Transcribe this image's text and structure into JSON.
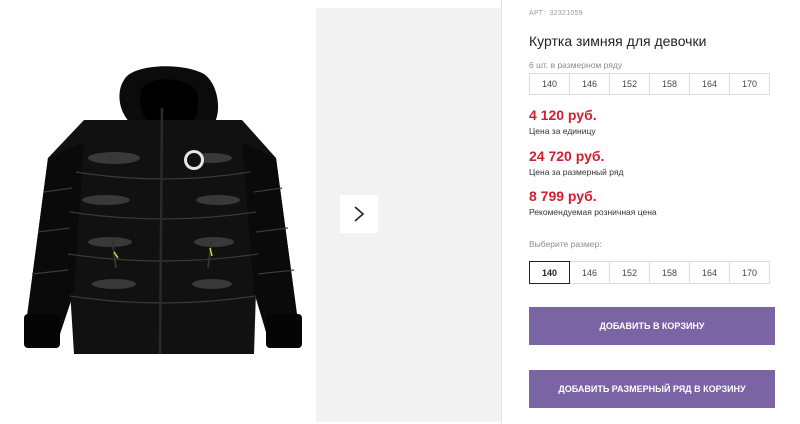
{
  "product": {
    "art_label": "АРТ:",
    "art_number": "32321059",
    "title": "Куртка зимняя для девочки",
    "image_alt": "Черная зимняя куртка"
  },
  "series": {
    "caption": "6 шт. в размерном ряду",
    "sizes": [
      "140",
      "146",
      "152",
      "158",
      "164",
      "170"
    ]
  },
  "prices": [
    {
      "value": "4 120 руб.",
      "label": "Цена за единицу"
    },
    {
      "value": "24 720 руб.",
      "label": "Цена за размерный ряд"
    },
    {
      "value": "8 799 руб.",
      "label": "Рекомендуемая розничная цена"
    }
  ],
  "size_select": {
    "caption": "Выберите размер:",
    "sizes": [
      "140",
      "146",
      "152",
      "158",
      "164",
      "170"
    ],
    "selected": "140"
  },
  "buttons": {
    "add_to_cart": "Добавить в корзину",
    "add_series_to_cart": "Добавить размерный ряд в корзину"
  },
  "gallery": {
    "next_icon": "chevron-right-icon"
  },
  "colors": {
    "price": "#d0202e",
    "button": "#7b64a3",
    "gallery_bg": "#f2f2f2"
  }
}
